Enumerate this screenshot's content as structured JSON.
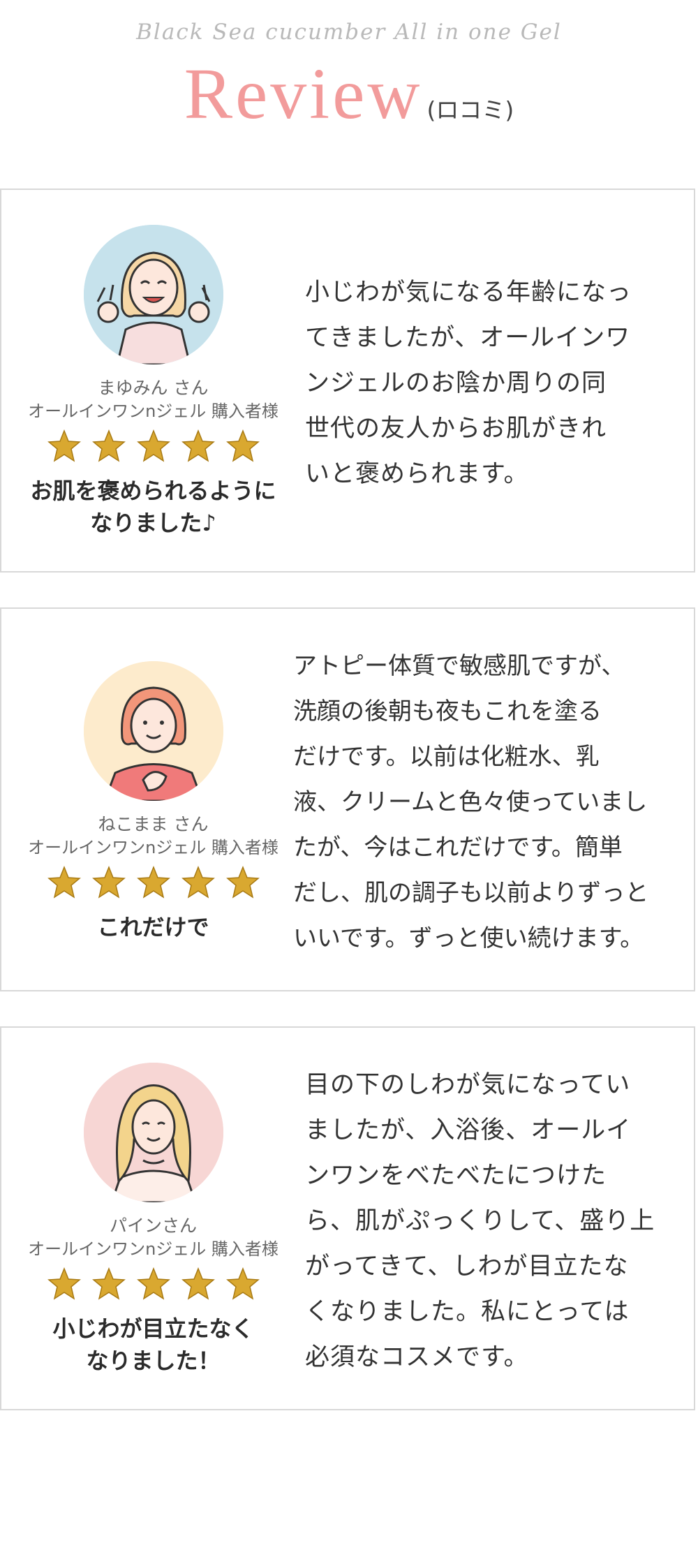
{
  "header": {
    "subtitle": "Black Sea cucumber All in one Gel",
    "title": "Review",
    "title_suffix": "(ロコミ)"
  },
  "reviews": [
    {
      "name": "まゆみん さん",
      "buyer": "オールインワンnジェル  購入者様",
      "rating": 5,
      "headline_line1": "お肌を褒められるように",
      "headline_line2": "なりました♪",
      "body_lines": [
        "小じわが気になる年齢になっ",
        "てきましたが、オールインワ",
        "ンジェルのお陰か周りの同",
        "世代の友人からお肌がきれ",
        "いと褒められます。"
      ],
      "avatar_bg": "#c6e2ec"
    },
    {
      "name": "ねこまま さん",
      "buyer": "オールインワンnジェル  購入者様",
      "rating": 5,
      "headline_line1": "これだけで",
      "headline_line2": "",
      "body_lines": [
        "アトピー体質で敏感肌ですが、",
        "洗顔の後朝も夜もこれを塗る",
        "だけです。以前は化粧水、乳",
        "液、クリームと色々使っていまし",
        "たが、今はこれだけです。簡単",
        "だし、肌の調子も以前よりずっと",
        "いいです。ずっと使い続けます。"
      ],
      "avatar_bg": "#fdebcc"
    },
    {
      "name": "パインさん",
      "buyer": "オールインワンnジェル  購入者様",
      "rating": 5,
      "headline_line1": "小じわが目立たなく",
      "headline_line2": "なりました！",
      "body_lines": [
        "目の下のしわが気になってい",
        "ましたが、入浴後、オールイ",
        "ンワンをべたべたにつけた",
        "ら、肌がぷっくりして、盛り上",
        "がってきて、しわが目立たな",
        "くなりました。私にとっては",
        "必須なコスメです。"
      ],
      "avatar_bg": "#f7d6d4"
    }
  ],
  "colors": {
    "title_pink": "#f29b9b",
    "star_gold": "#d9a830",
    "border": "#d8d8d8"
  }
}
